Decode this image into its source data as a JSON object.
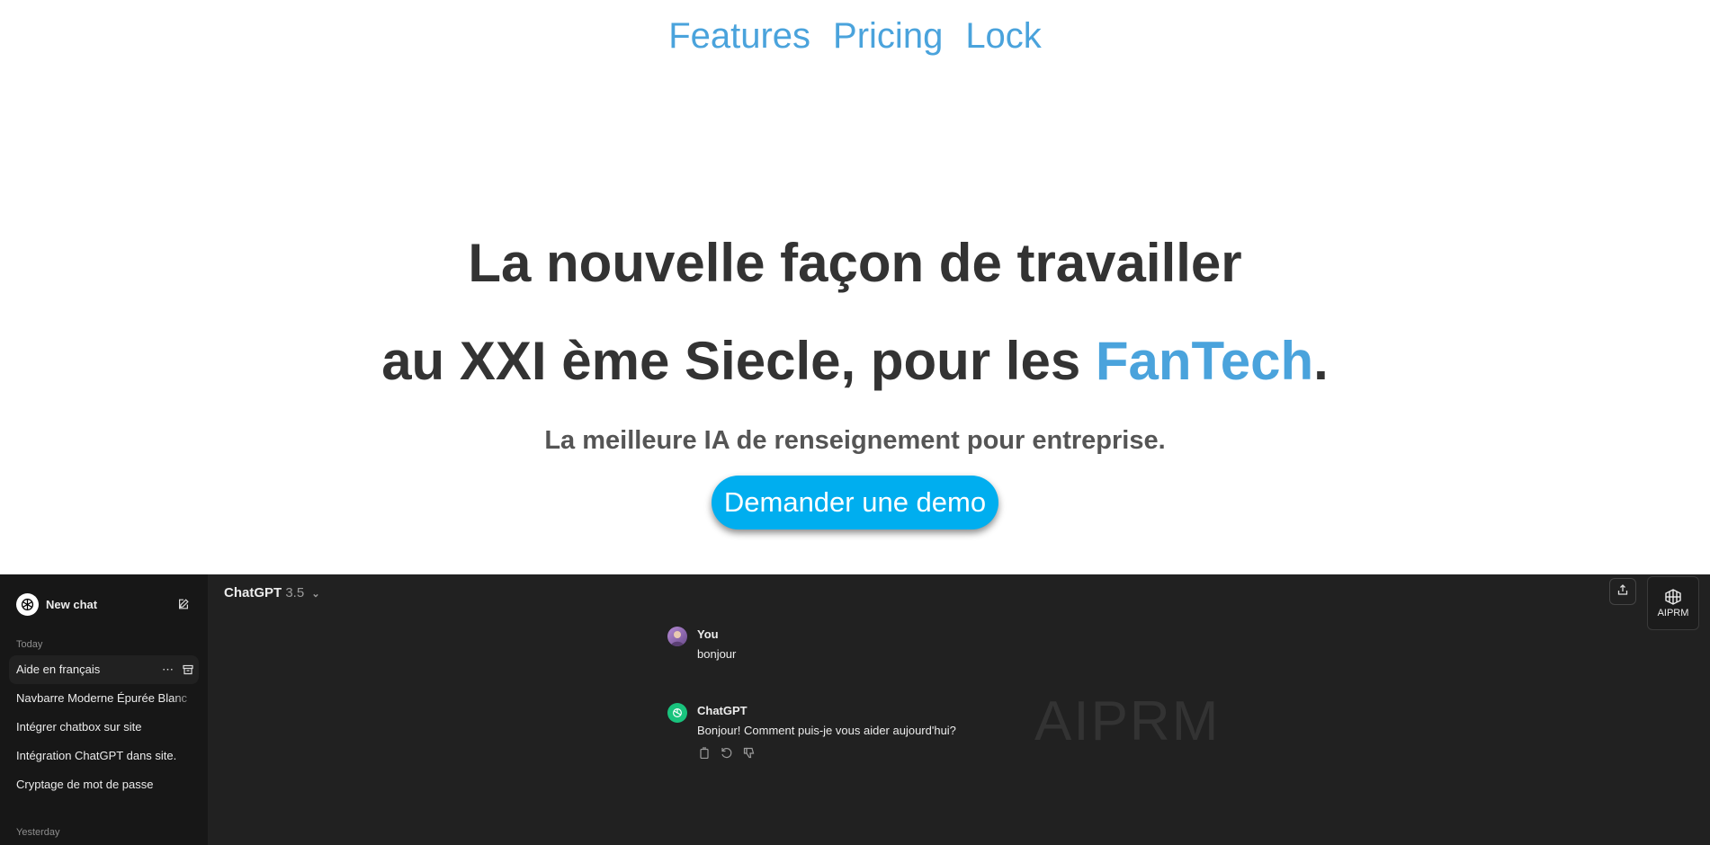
{
  "nav": {
    "links": [
      "Features",
      "Pricing",
      "Lock"
    ]
  },
  "hero": {
    "line1": "La nouvelle façon de travailler",
    "line2_prefix": "au XXI ème Siecle, pour les ",
    "brand": "FanTech",
    "line2_suffix": ".",
    "subtitle": "La meilleure IA de renseignement pour entreprise.",
    "cta_label": "Demander une demo"
  },
  "colors": {
    "accent": "#4aa3dc",
    "cta": "#00aeef",
    "app_bg": "#212121",
    "sidebar_bg": "#171717",
    "gpt_green": "#19c37d"
  },
  "sidebar": {
    "new_chat": "New chat",
    "today_label": "Today",
    "today_items": [
      "Aide en français",
      "Navbarre Moderne Épurée Blanc",
      "Intégrer chatbox sur site",
      "Intégration ChatGPT dans site.",
      "Cryptage de mot de passe"
    ],
    "yesterday_label": "Yesterday"
  },
  "header": {
    "model_name": "ChatGPT",
    "model_version": "3.5",
    "aiprm_label": "AIPRM"
  },
  "conversation": {
    "user_name": "You",
    "user_message": "bonjour",
    "assistant_name": "ChatGPT",
    "assistant_message": "Bonjour! Comment puis-je vous aider aujourd'hui?"
  },
  "watermark": "AIPRM"
}
